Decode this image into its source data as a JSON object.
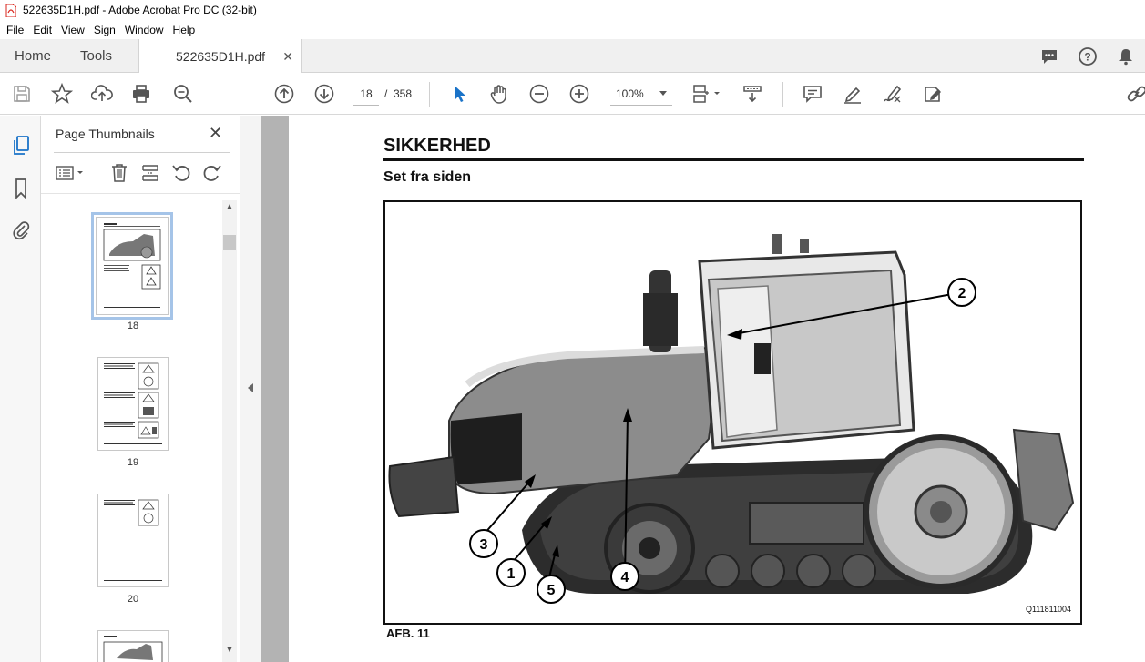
{
  "window": {
    "title": "522635D1H.pdf - Adobe Acrobat Pro DC (32-bit)"
  },
  "menu": [
    "File",
    "Edit",
    "View",
    "Sign",
    "Window",
    "Help"
  ],
  "tabs": {
    "home": "Home",
    "tools": "Tools",
    "document": "522635D1H.pdf"
  },
  "toolbar": {
    "current_page": "18",
    "separator": "/",
    "total_pages": "358",
    "zoom": "100%"
  },
  "thumbnails": {
    "title": "Page Thumbnails",
    "pages": [
      {
        "number": "18",
        "selected": true
      },
      {
        "number": "19",
        "selected": false
      },
      {
        "number": "20",
        "selected": false
      }
    ]
  },
  "document": {
    "heading": "SIKKERHED",
    "subheading": "Set fra siden",
    "figure_code": "Q111811004",
    "caption": "AFB. 11",
    "callouts": [
      "1",
      "2",
      "3",
      "4",
      "5"
    ]
  },
  "colors": {
    "accent_blue": "#1a73c8",
    "selected_thumb": "#a5c4e8",
    "pdf_red": "#d9251c"
  }
}
